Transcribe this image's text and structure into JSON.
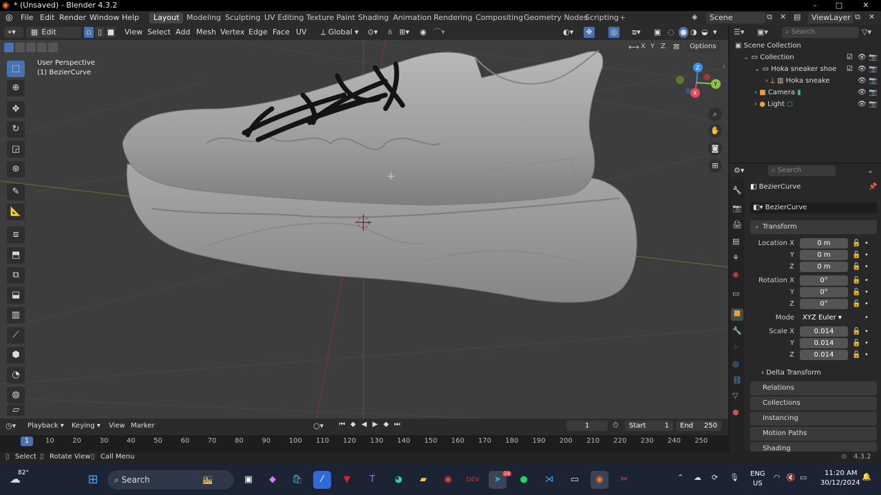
{
  "window": {
    "title": "* (Unsaved) - Blender 4.3.2",
    "minimize": "–",
    "maximize": "□",
    "close": "✕"
  },
  "menus": [
    "File",
    "Edit",
    "Render",
    "Window",
    "Help"
  ],
  "workspaces": [
    "Layout",
    "Modeling",
    "Sculpting",
    "UV Editing",
    "Texture Paint",
    "Shading",
    "Animation",
    "Rendering",
    "Compositing",
    "Geometry Nodes",
    "Scripting"
  ],
  "add_workspace": "+",
  "scene": {
    "name": "Scene",
    "view_layer": "ViewLayer"
  },
  "viewport_header": {
    "mode": "Edit Mode",
    "items": [
      "View",
      "Select",
      "Add",
      "Mesh",
      "Vertex",
      "Edge",
      "Face",
      "UV"
    ],
    "orientation": "Global",
    "options": "Options",
    "axes": [
      "X",
      "Y",
      "Z"
    ]
  },
  "viewport": {
    "perspective": "User Perspective",
    "object": "(1) BezierCurve"
  },
  "gizmo": {
    "x": "X",
    "y": "Y",
    "z": "Z"
  },
  "outliner": {
    "search_placeholder": "Search",
    "root": "Scene Collection",
    "items": [
      {
        "label": "Collection",
        "indent": 1,
        "icon": "collection-icon"
      },
      {
        "label": "Hoka sneaker shoe",
        "indent": 2,
        "icon": "collection-icon"
      },
      {
        "label": "Hoka sneake",
        "indent": 3,
        "icon": "mesh-icon"
      },
      {
        "label": "Camera",
        "indent": 2,
        "icon": "camera-icon"
      },
      {
        "label": "Light",
        "indent": 2,
        "icon": "light-icon"
      }
    ]
  },
  "properties": {
    "search_placeholder": "Search",
    "object_name": "BezierCurve",
    "data_name": "BezierCurve",
    "transform_title": "Transform",
    "location": {
      "label": "Location X",
      "y_label": "Y",
      "z_label": "Z",
      "x": "0 m",
      "y": "0 m",
      "z": "0 m"
    },
    "rotation": {
      "label": "Rotation X",
      "y_label": "Y",
      "z_label": "Z",
      "x": "0°",
      "y": "0°",
      "z": "0°"
    },
    "mode": {
      "label": "Mode",
      "value": "XYZ Euler"
    },
    "scale": {
      "label": "Scale X",
      "y_label": "Y",
      "z_label": "Z",
      "x": "0.014",
      "y": "0.014",
      "z": "0.014"
    },
    "panels": [
      "Delta Transform",
      "Relations",
      "Collections",
      "Instancing",
      "Motion Paths",
      "Shading"
    ]
  },
  "timeline": {
    "menus": [
      "Playback",
      "Keying",
      "View",
      "Marker"
    ],
    "current_frame": "1",
    "start_label": "Start",
    "start": "1",
    "end_label": "End",
    "end": "250",
    "ticks": [
      "1",
      "10",
      "20",
      "30",
      "40",
      "50",
      "60",
      "70",
      "80",
      "90",
      "100",
      "110",
      "120",
      "130",
      "140",
      "150",
      "160",
      "170",
      "180",
      "190",
      "200",
      "210",
      "220",
      "230",
      "240",
      "250"
    ]
  },
  "statusbar": {
    "select": "Select",
    "rotate": "Rotate View",
    "menu": "Call Menu",
    "version": "4.3.2"
  },
  "taskbar": {
    "weather": "82°",
    "search": "Search",
    "lang": "ENG",
    "region": "US",
    "time": "11:20 AM",
    "date": "30/12/2024",
    "telegram_badge": "24"
  },
  "colors": {
    "accent": "#4772b3",
    "x_axis": "#e8475a",
    "y_axis": "#8bc34a",
    "z_axis": "#3b8fe0"
  }
}
